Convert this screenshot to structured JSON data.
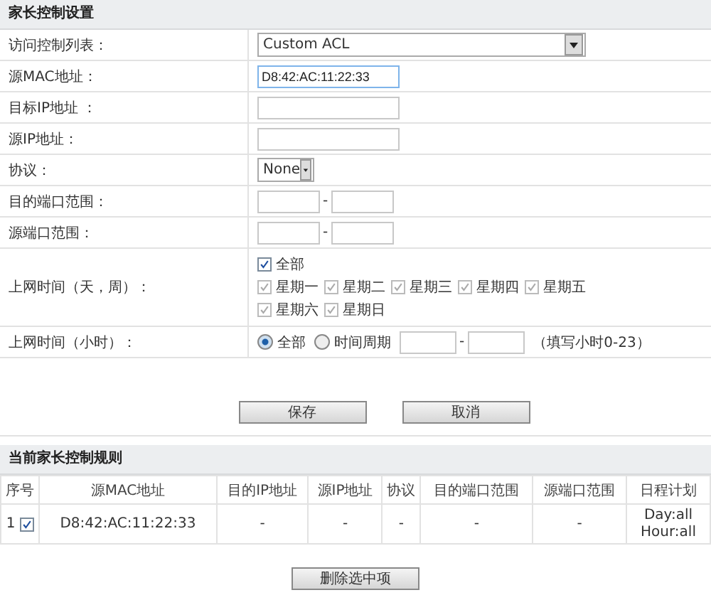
{
  "settings": {
    "title": "家长控制设置",
    "rows": [
      {
        "kind": "select",
        "label": "访问控制列表：",
        "value": "Custom ACL",
        "wide": true
      },
      {
        "kind": "text",
        "label": "源MAC地址：",
        "value": "D8:42:AC:11:22:33",
        "focused": true
      },
      {
        "kind": "text",
        "label": "目标IP地址 ："
      },
      {
        "kind": "text",
        "label": "源IP地址："
      },
      {
        "kind": "select",
        "label": "协议：",
        "value": "None",
        "wide": false
      },
      {
        "kind": "range",
        "label": "目的端口范围：",
        "separator": "-"
      },
      {
        "kind": "range",
        "label": "源端口范围：",
        "separator": "-"
      },
      {
        "kind": "days",
        "label": "上网时间（天，周）：",
        "all": {
          "label": "全部",
          "checked": true,
          "disabled": false
        },
        "days": [
          {
            "label": "星期一",
            "checked": true,
            "disabled": true
          },
          {
            "label": "星期二",
            "checked": true,
            "disabled": true
          },
          {
            "label": "星期三",
            "checked": true,
            "disabled": true
          },
          {
            "label": "星期四",
            "checked": true,
            "disabled": true
          },
          {
            "label": "星期五",
            "checked": true,
            "disabled": true
          },
          {
            "label": "星期六",
            "checked": true,
            "disabled": true
          },
          {
            "label": "星期日",
            "checked": true,
            "disabled": true
          }
        ]
      },
      {
        "kind": "hours",
        "label": "上网时间（小时）：",
        "options": [
          {
            "label": "全部",
            "selected": true
          },
          {
            "label": "时间周期",
            "selected": false
          }
        ],
        "separator": "-",
        "hint": "（填写小时0-23）"
      }
    ],
    "buttons": [
      "保存",
      "取消"
    ]
  },
  "rules": {
    "title": "当前家长控制规则",
    "columns": [
      "序号",
      "源MAC地址",
      "目的IP地址",
      "源IP地址",
      "协议",
      "目的端口范围",
      "源端口范围",
      "日程计划"
    ],
    "rows": [
      {
        "checked": true,
        "cells": [
          "1",
          "D8:42:AC:11:22:33",
          "-",
          "-",
          "-",
          "-",
          "-",
          "Day:all Hour:all"
        ]
      }
    ],
    "delete_button": "删除选中项"
  }
}
